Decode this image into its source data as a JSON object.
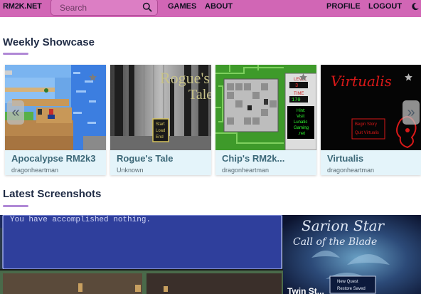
{
  "nav": {
    "brand": "RM2K.NET",
    "search_placeholder": "Search",
    "games": "GAMES",
    "about": "ABOUT",
    "profile": "PROFILE",
    "logout": "LOGOUT",
    "theme_icon": "moon-icon"
  },
  "showcase": {
    "heading": "Weekly Showcase",
    "prev_arrow": "«",
    "next_arrow": "»",
    "cards": [
      {
        "title": "Apocalypse RM2k3",
        "author": "dragonheartman"
      },
      {
        "title": "Rogue's Tale",
        "author": "Unknown",
        "art_text": [
          "Rogue's",
          "Tale"
        ],
        "menu": [
          "Start",
          "Load",
          "End"
        ]
      },
      {
        "title": "Chip's RM2k...",
        "author": "dragonheartman",
        "side_labels": [
          "LEVEL",
          "TIME"
        ],
        "side_values": [
          "3",
          "170"
        ],
        "hint": [
          "Hint:",
          "Visit",
          "Lunatic",
          "Gaming",
          ".net"
        ]
      },
      {
        "title": "Virtualis",
        "author": "dragonheartman",
        "art_text": "Virtualis",
        "menu": [
          "Begin Story",
          "Quit Virtualis"
        ]
      }
    ]
  },
  "latest": {
    "heading": "Latest Screenshots",
    "shot1_text": "You have accomplished nothing.",
    "shot2_title": "Sarion Star",
    "shot2_subtitle": "Call of the Blade",
    "shot2_menu": [
      "New Quest",
      "Restore Saved"
    ],
    "shot2_caption": "Twin St..."
  },
  "colors": {
    "navbar": "#d166b5",
    "accent_underline": "#b088d6",
    "card_bg": "#e4f4fa",
    "card_title": "#3c6878"
  }
}
